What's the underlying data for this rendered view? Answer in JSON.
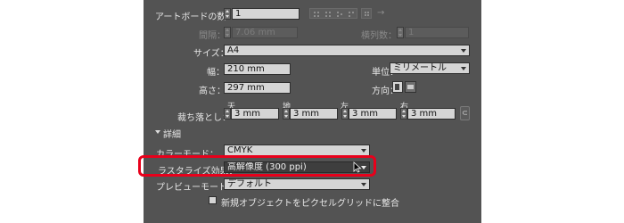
{
  "artboards": {
    "label": "アートボードの数：",
    "count": "1"
  },
  "spacing": {
    "label": "間隔：",
    "value": "7.06 mm",
    "columns_label": "横列数：",
    "columns_value": "1"
  },
  "size": {
    "label": "サイズ：",
    "value": "A4"
  },
  "width": {
    "label": "幅：",
    "value": "210 mm"
  },
  "unit": {
    "label": "単位：",
    "value": "ミリメートル"
  },
  "height": {
    "label": "高さ：",
    "value": "297 mm"
  },
  "orientation": {
    "label": "方向："
  },
  "bleed": {
    "label": "裁ち落とし：",
    "top_label": "天",
    "bottom_label": "地",
    "left_label": "左",
    "right_label": "右",
    "top": "3 mm",
    "bottom": "3 mm",
    "left": "3 mm",
    "right": "3 mm"
  },
  "advanced": {
    "label": "詳細"
  },
  "color_mode": {
    "label": "カラーモード：",
    "value": "CMYK"
  },
  "raster_effects": {
    "label": "ラスタライズ効果：",
    "value": "高解像度 (300 ppi)"
  },
  "preview_mode": {
    "label": "プレビューモード：",
    "value": "デフォルト"
  },
  "pixel_grid": {
    "label": "新規オブジェクトをピクセルグリッドに整合"
  },
  "colors": {
    "highlight": "#e8001b",
    "panel": "#535353"
  }
}
